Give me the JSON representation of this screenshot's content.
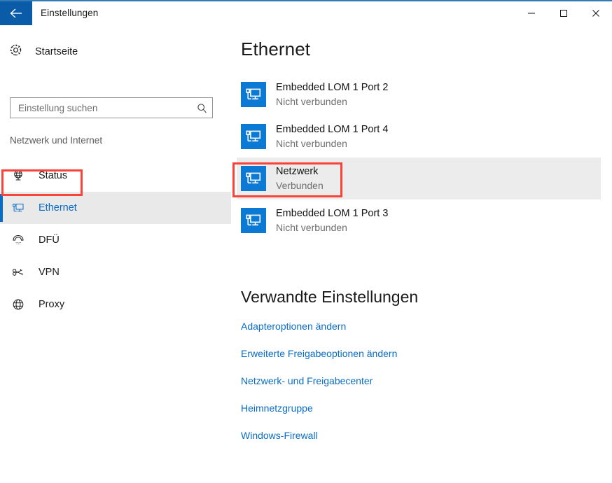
{
  "window": {
    "title": "Einstellungen",
    "back_icon": "back-arrow-icon",
    "controls": {
      "minimize": "—",
      "maximize": "▢",
      "close": "✕"
    },
    "accent_color": "#0a5ba8",
    "link_color": "#0a6cc4",
    "annotation_color": "#f9423a"
  },
  "sidebar": {
    "home": {
      "label": "Startseite",
      "icon": "gear-icon"
    },
    "search": {
      "placeholder": "Einstellung suchen",
      "value": "",
      "icon": "search-icon"
    },
    "category": "Netzwerk und Internet",
    "items": [
      {
        "label": "Status",
        "icon": "globe-stand-icon",
        "selected": false
      },
      {
        "label": "Ethernet",
        "icon": "ethernet-monitor-icon",
        "selected": true
      },
      {
        "label": "DFÜ",
        "icon": "phone-handset-icon",
        "selected": false
      },
      {
        "label": "VPN",
        "icon": "vpn-key-icon",
        "selected": false
      },
      {
        "label": "Proxy",
        "icon": "globe-icon",
        "selected": false
      }
    ]
  },
  "main": {
    "title": "Ethernet",
    "adapters": [
      {
        "name": "Embedded LOM 1 Port 2",
        "status": "Nicht verbunden",
        "icon": "network-adapter-icon",
        "highlighted": false
      },
      {
        "name": "Embedded LOM 1 Port 4",
        "status": "Nicht verbunden",
        "icon": "network-adapter-icon",
        "highlighted": false
      },
      {
        "name": "Netzwerk",
        "status": "Verbunden",
        "icon": "network-adapter-icon",
        "highlighted": true
      },
      {
        "name": "Embedded LOM 1 Port 3",
        "status": "Nicht verbunden",
        "icon": "network-adapter-icon",
        "highlighted": false
      }
    ],
    "related": {
      "title": "Verwandte Einstellungen",
      "links": [
        "Adapteroptionen ändern",
        "Erweiterte Freigabeoptionen ändern",
        "Netzwerk- und Freigabecenter",
        "Heimnetzgruppe",
        "Windows-Firewall"
      ]
    }
  }
}
